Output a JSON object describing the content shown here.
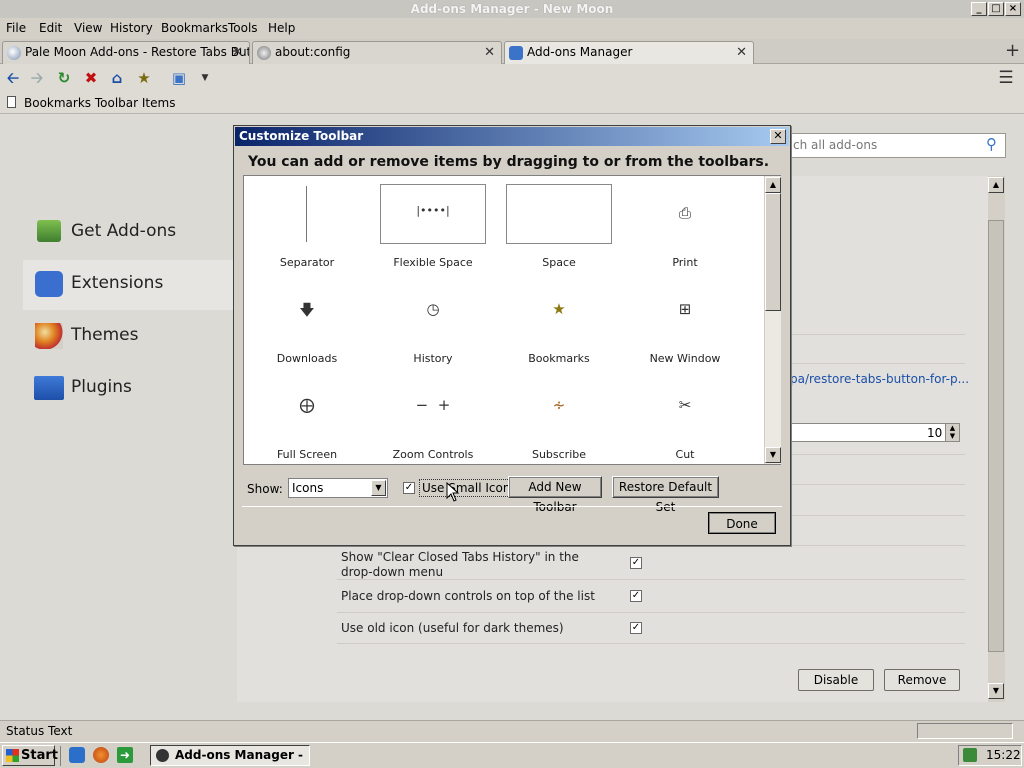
{
  "window": {
    "title": "Add-ons Manager - New Moon"
  },
  "menu": [
    "File",
    "Edit",
    "View",
    "History",
    "Bookmarks",
    "Tools",
    "Help"
  ],
  "tabs": [
    {
      "label": "Pale Moon Add-ons - Restore Tabs Button"
    },
    {
      "label": "about:config"
    },
    {
      "label": "Add-ons Manager"
    }
  ],
  "bookmarks": {
    "label": "Bookmarks Toolbar Items"
  },
  "sidebar": {
    "items": [
      {
        "label": "Get Add-ons"
      },
      {
        "label": "Extensions"
      },
      {
        "label": "Themes"
      },
      {
        "label": "Plugins"
      }
    ]
  },
  "search": {
    "placeholder": "Search all add-ons",
    "visible_text": "ch all add-ons"
  },
  "detail": {
    "link": "pa/restore-tabs-button-for-p...",
    "number_value": "10",
    "options": [
      {
        "label": "Show \"Clear Closed Tabs History\" in the drop-down menu",
        "checked": true
      },
      {
        "label": "Place drop-down controls on top of the list",
        "checked": true
      },
      {
        "label": "Use old icon (useful for dark themes)",
        "checked": true
      }
    ],
    "disable_label": "Disable",
    "remove_label": "Remove"
  },
  "dialog": {
    "title": "Customize Toolbar",
    "instruction": "You can add or remove items by dragging to or from the toolbars.",
    "items": [
      {
        "label": "Separator"
      },
      {
        "label": "Flexible Space"
      },
      {
        "label": "Space"
      },
      {
        "label": "Print"
      },
      {
        "label": "Downloads"
      },
      {
        "label": "History"
      },
      {
        "label": "Bookmarks"
      },
      {
        "label": "New Window"
      },
      {
        "label": "Full Screen"
      },
      {
        "label": "Zoom Controls"
      },
      {
        "label": "Subscribe"
      },
      {
        "label": "Cut"
      }
    ],
    "show_label": "Show:",
    "show_value": "Icons",
    "small_icons_label": "Use Small Icons",
    "small_icons_checked": true,
    "add_toolbar_label": "Add New Toolbar",
    "restore_label": "Restore Default Set",
    "done_label": "Done"
  },
  "status": {
    "text": "Status Text"
  },
  "taskbar": {
    "start_label": "Start",
    "task_label": "Add-ons Manager - N...",
    "clock": "15:22"
  },
  "colors": {
    "dialog_title_start": "#0a246a",
    "dialog_title_end": "#a6caf0",
    "link": "#1a4fa8"
  }
}
